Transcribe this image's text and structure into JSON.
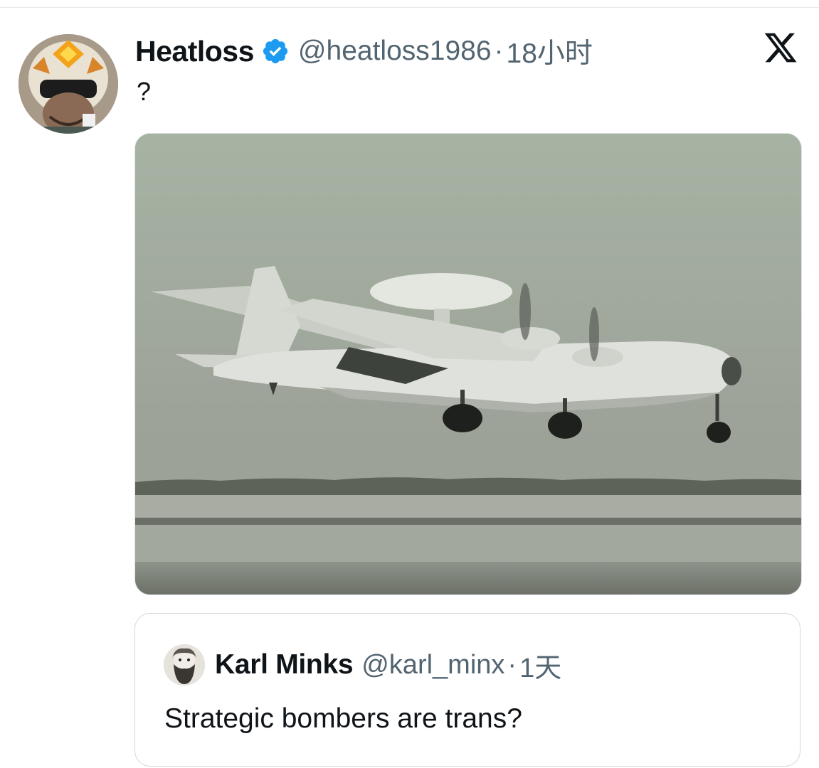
{
  "tweet": {
    "display_name": "Heatloss",
    "handle": "@heatloss1986",
    "separator": "·",
    "time": "18小时",
    "text": "?"
  },
  "quoted_tweet": {
    "display_name": "Karl Minks",
    "handle": "@karl_minx",
    "separator": "·",
    "time": "1天",
    "text": "Strategic bombers are trans?"
  },
  "icons": {
    "verified": "verified-badge-icon",
    "brand": "x-logo-icon"
  },
  "colors": {
    "verified_blue": "#1d9bf0",
    "secondary_text": "#536471",
    "primary_text": "#0f1419"
  }
}
